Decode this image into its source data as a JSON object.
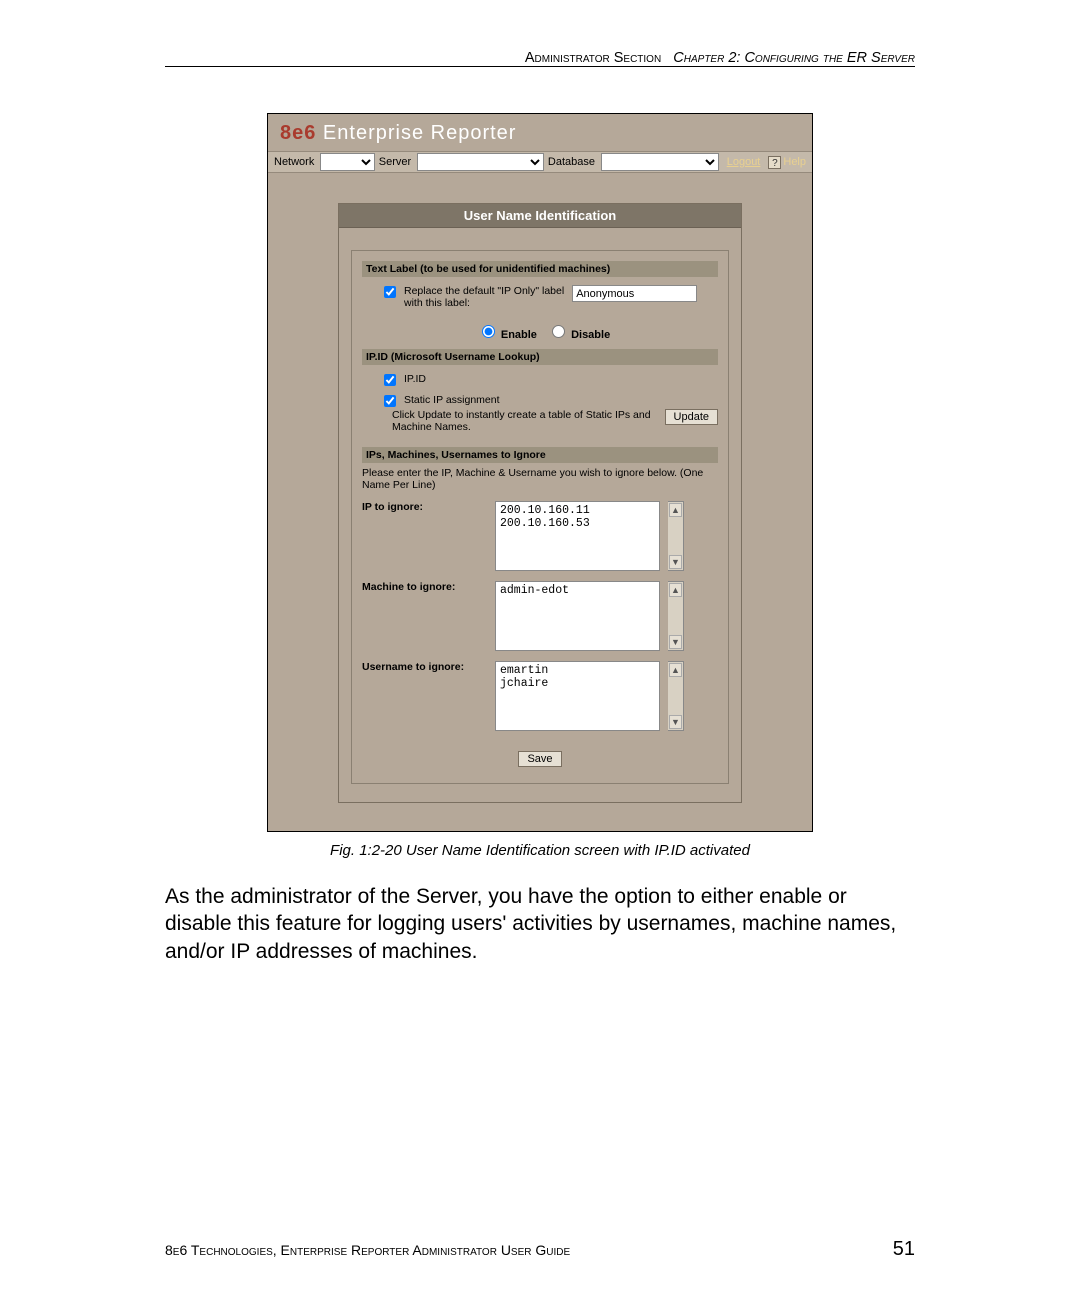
{
  "header": {
    "section": "Administrator Section",
    "chapter": "Chapter 2: Configuring the ER Server"
  },
  "app": {
    "brand_accent": "8e6",
    "brand_rest": " Enterprise Reporter",
    "menubar": {
      "network_label": "Network",
      "server_label": "Server",
      "database_label": "Database",
      "logout": "Logout",
      "help_glyph": "?",
      "help_text": "Help"
    },
    "panel_title": "User Name Identification",
    "sections": {
      "text_label_head": "Text Label (to be used for unidentified machines)",
      "replace_checked": true,
      "replace_label_line1": "Replace the default \"IP Only\" label",
      "replace_label_line2": "with this label:",
      "replace_value": "Anonymous",
      "enable_label": "Enable",
      "disable_label": "Disable",
      "enable_selected": true,
      "ipid_head": "IP.ID (Microsoft Username Lookup)",
      "ipid_checked": true,
      "ipid_label": "IP.ID",
      "static_checked": true,
      "static_label": "Static IP assignment",
      "static_desc": "Click Update to instantly create a table of Static IPs and Machine Names.",
      "update_button": "Update",
      "ignore_head": "IPs, Machines, Usernames to Ignore",
      "ignore_help": "Please enter the IP, Machine & Username you wish to ignore below. (One Name Per Line)",
      "ip_ignore_label": "IP to ignore:",
      "ip_ignore_value": "200.10.160.11\n200.10.160.53",
      "machine_ignore_label": "Machine to ignore:",
      "machine_ignore_value": "admin-edot",
      "username_ignore_label": "Username to ignore:",
      "username_ignore_value": "emartin\njchaire",
      "save_button": "Save"
    }
  },
  "caption": "Fig. 1:2-20  User Name Identification screen with IP.ID activated",
  "body_text": "As the administrator of the Server, you have the option to either enable or disable this feature for logging users' activities by usernames, machine names, and/or IP addresses of machines.",
  "footer": {
    "text": "8e6 Technologies, Enterprise Reporter Administrator User Guide",
    "page": "51"
  }
}
